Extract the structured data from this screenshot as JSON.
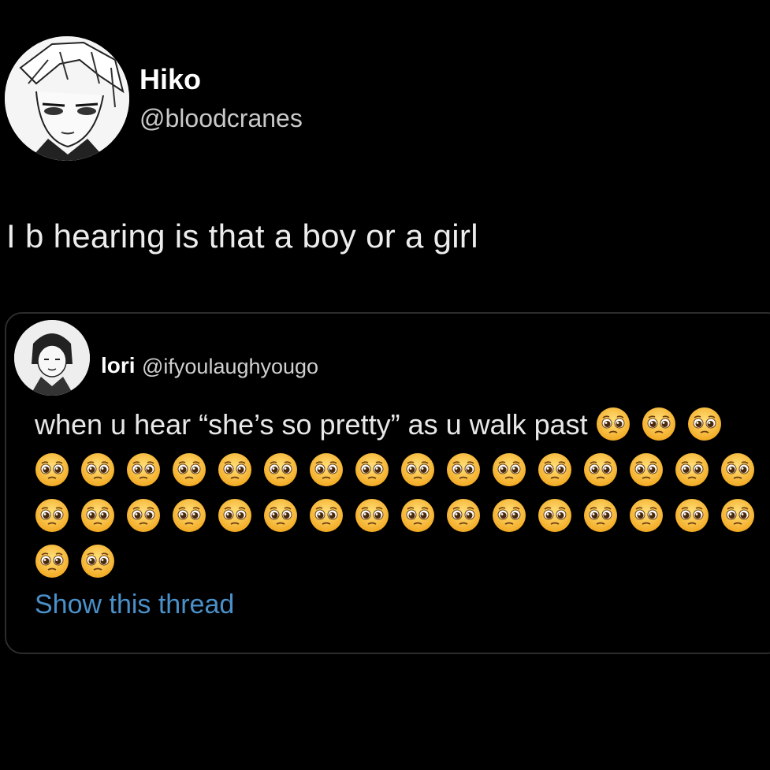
{
  "author": {
    "name": "Hiko",
    "handle": "@bloodcranes"
  },
  "tweet_text": "I b hearing is that a boy or a girl",
  "quoted": {
    "name": "lori",
    "handle": "@ifyoulaughyougo",
    "text": "when u hear “she’s so pretty” as u walk past",
    "emoji": "pleading-face",
    "emoji_count": 37,
    "thread_link": "Show this thread"
  },
  "colors": {
    "background": "#000000",
    "link": "#4a90c9",
    "border": "#2c2c2c"
  }
}
